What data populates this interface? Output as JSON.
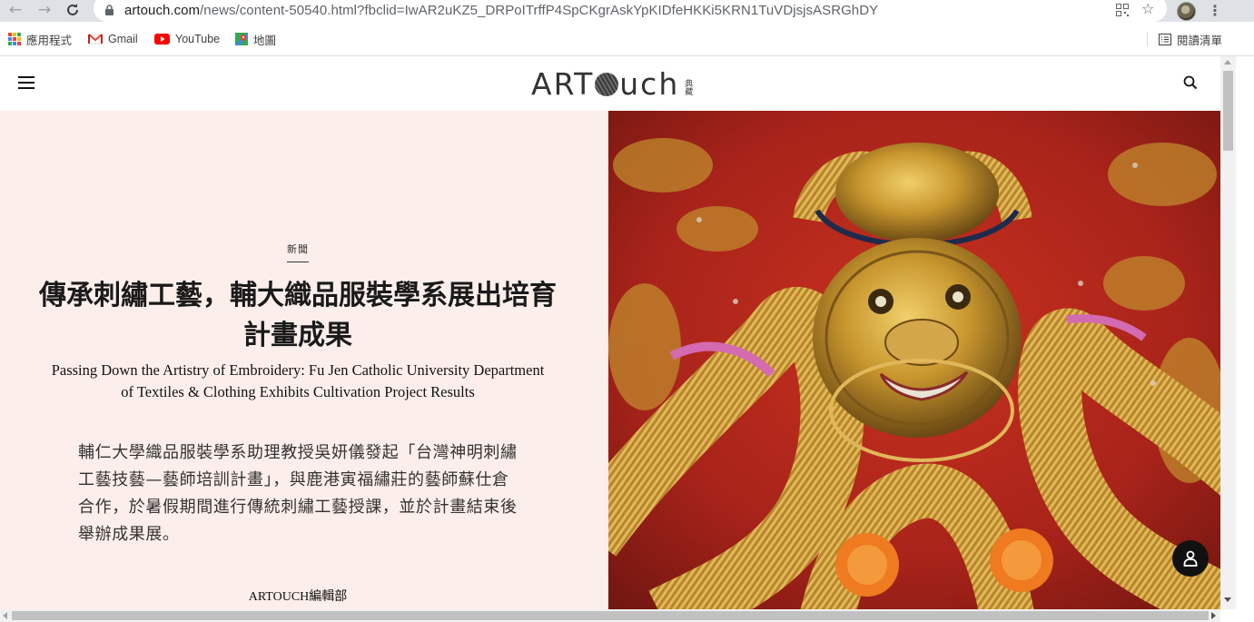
{
  "browser": {
    "url_host": "artouch.com",
    "url_path": "/news/content-50540.html?fbclid=IwAR2uKZ5_DRPoITrffP4SpCKgrAskYpKIDfeHKKi5KRN1TuVDjsjsASRGhDY",
    "icons": {
      "back": "back-arrow-icon",
      "forward": "forward-arrow-icon",
      "reload": "reload-icon",
      "lock": "lock-icon",
      "qr": "qr-code-icon",
      "star": "star-icon",
      "menu": "kebab-menu-icon"
    }
  },
  "bookmarks": {
    "apps": "應用程式",
    "gmail": "Gmail",
    "youtube": "YouTube",
    "maps": "地圖",
    "reading_list": "閱讀清單"
  },
  "site": {
    "logo_text_left": "ART",
    "logo_text_right": "uch",
    "logo_cjk": "典藏",
    "icons": {
      "menu": "hamburger-menu-icon",
      "search": "search-icon",
      "user": "user-icon"
    }
  },
  "article": {
    "category": "新聞",
    "title_zh": "傳承刺繡工藝，輔大織品服裝學系展出培育計畫成果",
    "title_en": "Passing Down the Artistry of Embroidery: Fu Jen Catholic University Department of Textiles & Clothing Exhibits Cultivation Project Results",
    "lead": "輔仁大學織品服裝學系助理教授吳妍儀發起「台灣神明刺繡工藝技藝—藝師培訓計畫」，與鹿港寅福繡莊的藝師蘇仕倉合作，於暑假期間進行傳統刺繡工藝授課，並於計畫結束後舉辦成果展。",
    "author": "ARTOUCH編輯部"
  },
  "colors": {
    "hero_bg": "#fcefeb",
    "embroidery_red": "#b8281a",
    "embroidery_gold": "#c8962e"
  }
}
